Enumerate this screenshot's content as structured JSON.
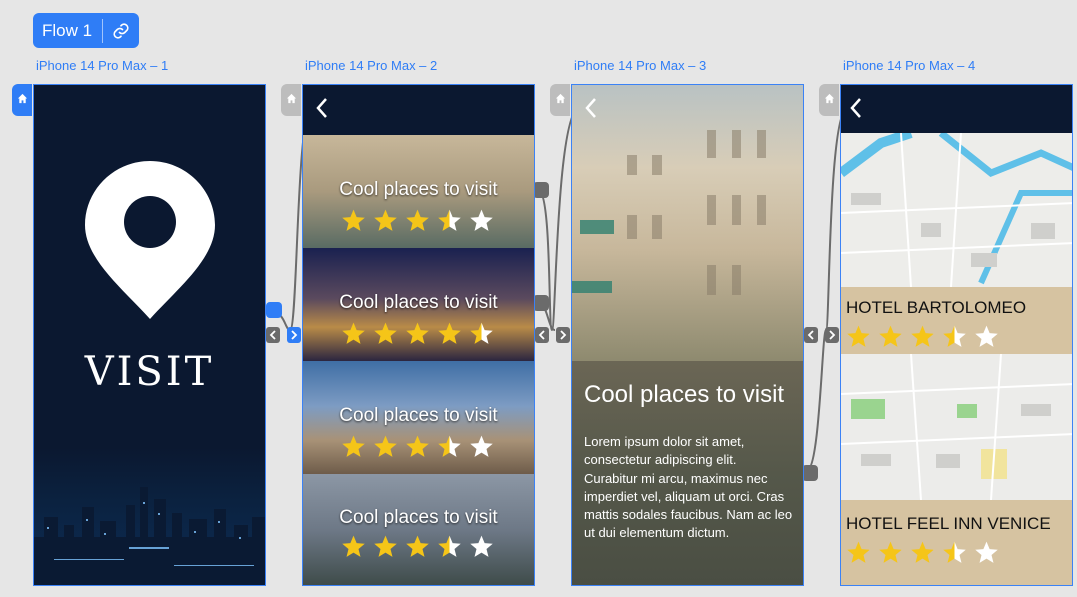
{
  "flow": {
    "label": "Flow 1",
    "link_icon": "link-icon"
  },
  "frames": [
    {
      "title": "iPhone 14 Pro Max – 1"
    },
    {
      "title": "iPhone 14 Pro Max – 2"
    },
    {
      "title": "iPhone 14 Pro Max – 3"
    },
    {
      "title": "iPhone 14 Pro Max – 4"
    }
  ],
  "screen1": {
    "brand": "VISIT",
    "icon": "map-pin-icon"
  },
  "screen2": {
    "back_icon": "chevron-left-icon",
    "cards": [
      {
        "title": "Cool places to visit",
        "rating": 3.5
      },
      {
        "title": "Cool places to visit",
        "rating": 4.5
      },
      {
        "title": "Cool places to visit",
        "rating": 3.5
      },
      {
        "title": "Cool places to visit",
        "rating": 3.5
      }
    ]
  },
  "screen3": {
    "back_icon": "chevron-left-icon",
    "title": "Cool places to visit",
    "body": "Lorem ipsum dolor sit amet, consectetur adipiscing elit. Curabitur mi arcu, maximus nec imperdiet vel, aliquam ut orci. Cras mattis sodales faucibus. Nam ac leo ut dui elementum dictum."
  },
  "screen4": {
    "back_icon": "chevron-left-icon",
    "hotels": [
      {
        "name": "HOTEL BARTOLOMEO",
        "rating": 3.5
      },
      {
        "name": "HOTEL FEEL INN VENICE",
        "rating": 3.5
      }
    ]
  },
  "colors": {
    "accent": "#2f7df6",
    "dark": "#0b1830",
    "star": "#f5c518",
    "hotel_bg": "#d6c3a1"
  }
}
